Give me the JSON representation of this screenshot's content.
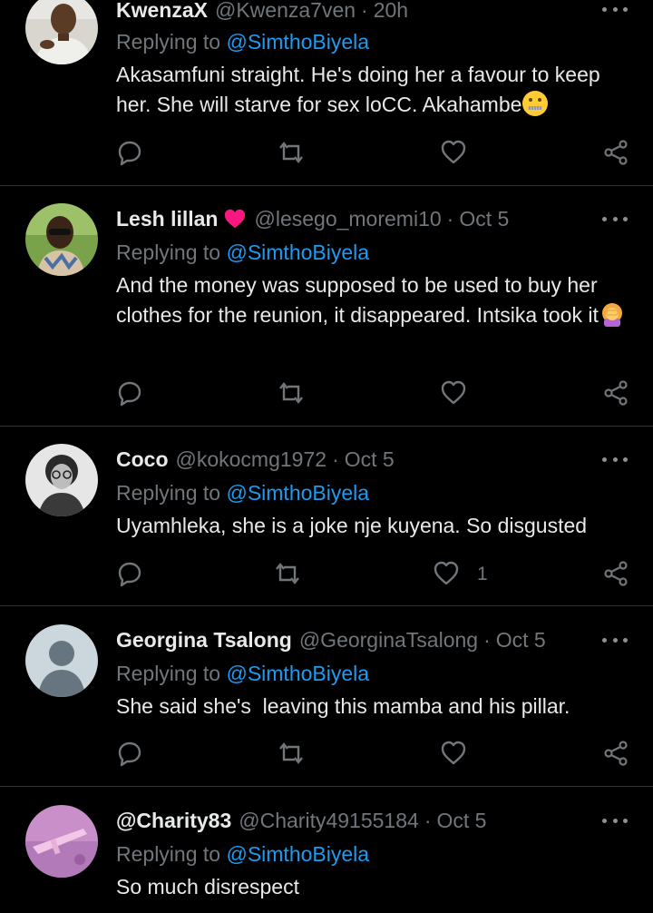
{
  "replying_prefix": "Replying to ",
  "tweets": [
    {
      "name": "KwenzaX",
      "handle": "@Kwenza7ven",
      "separator": "·",
      "time": "20h",
      "replying_to": "@SimthoBiyela",
      "text": "Akasamfuni straight. He's doing her a favour to keep her. She will starve for sex loCC. Akahambe",
      "emoji": "zipper-mouth-face-icon",
      "likes": "",
      "avatar": "man-avatar-photo"
    },
    {
      "name": "Lesh lillan",
      "name_badge": "red-heart-icon",
      "handle": "@lesego_moremi10",
      "separator": "·",
      "time": "Oct 5",
      "replying_to": "@SimthoBiyela",
      "text": "And the money was supposed to be used to buy her clothes for the reunion, it disappeared. Intsika took it",
      "emoji": "person-facepalming-icon",
      "likes": "",
      "avatar": "woman-sunglasses-avatar-photo"
    },
    {
      "name": "Coco",
      "handle": "@kokocmg1972",
      "separator": "·",
      "time": "Oct 5",
      "replying_to": "@SimthoBiyela",
      "text": "Uyamhleka, she is a joke nje kuyena. So disgusted",
      "likes": "1",
      "avatar": "woman-glasses-bw-avatar-photo"
    },
    {
      "name": "Georgina Tsalong",
      "handle": "@GeorginaTsalong",
      "separator": "·",
      "time": "Oct 5",
      "replying_to": "@SimthoBiyela",
      "text": "She said she's  leaving this mamba and his pillar.",
      "likes": "",
      "avatar": "default-avatar"
    },
    {
      "name": "@Charity83",
      "handle": "@Charity49155184",
      "separator": "·",
      "time": "Oct 5",
      "replying_to": "@SimthoBiyela",
      "text": "So much disrespect",
      "likes": "",
      "avatar": "pink-rifle-avatar-image"
    }
  ],
  "colors": {
    "background": "#000000",
    "primary_text": "#e7e9ea",
    "secondary_text": "#71767b",
    "mention": "#1d9bf0",
    "divider": "#2f3336",
    "heart_badge": "#f91880"
  }
}
